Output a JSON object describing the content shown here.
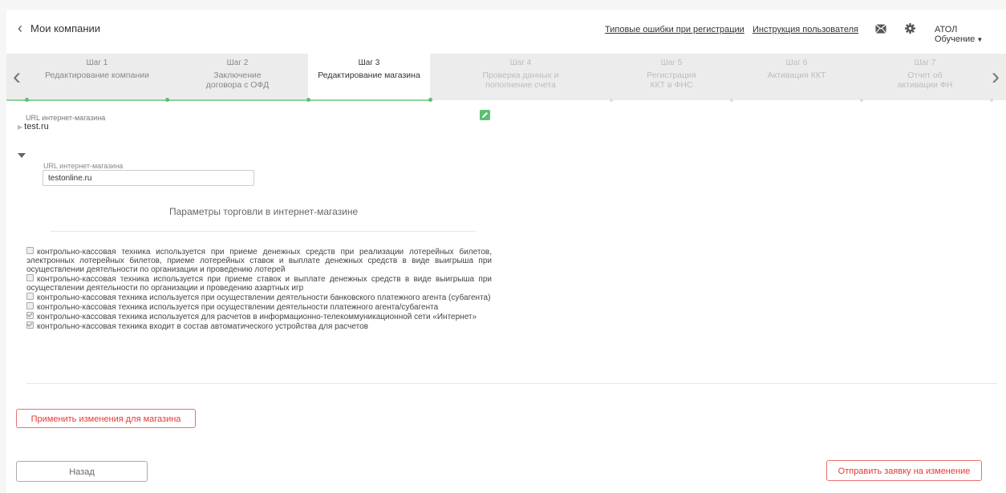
{
  "header": {
    "back_label": "Мои компании",
    "link_errors": "Типовые ошибки при регистрации",
    "link_manual": "Инструкция пользователя",
    "user_name": "АТОЛ Обучение"
  },
  "steps": [
    {
      "title": "Шаг 1",
      "desc": "Редактирование компании"
    },
    {
      "title": "Шаг 2",
      "desc": "Заключение договора с ОФД"
    },
    {
      "title": "Шаг 3",
      "desc": "Редактирование магазина"
    },
    {
      "title": "Шаг 4",
      "desc": "Проверка данных и пополнение счета"
    },
    {
      "title": "Шаг 5",
      "desc": "Регистрация ККТ в ФНС"
    },
    {
      "title": "Шаг 6",
      "desc": "Активация ККТ"
    },
    {
      "title": "Шаг 7",
      "desc": "Отчет об активации ФН"
    }
  ],
  "store": {
    "url_label": "URL интернет-магазина",
    "url_value": "test.ru"
  },
  "form": {
    "url_label": "URL интернет-магазина",
    "url_value": "testonline.ru",
    "section_title": "Параметры торговли в интернет-магазине",
    "options": [
      {
        "label": "контрольно-кассовая техника используется при приеме денежных средств при реализации лотерейных билетов, электронных лотерейных билетов, приеме лотерейных ставок и выплате денежных средств в виде выигрыша при осуществлении деятельности по организации и проведению лотерей",
        "checked": false
      },
      {
        "label": "контрольно-кассовая техника используется при приеме ставок и выплате денежных средств в виде выигрыша при осуществлении деятельности по организации и проведению азартных игр",
        "checked": false
      },
      {
        "label": "контрольно-кассовая техника используется при осуществлении деятельности банковского платежного агента (субагента)",
        "checked": false
      },
      {
        "label": "контрольно-кассовая техника используется при осуществлении деятельности платежного агента/субагента",
        "checked": false
      },
      {
        "label": "контрольно-кассовая техника используется для расчетов в информационно-телекоммуникационной сети «Интернет»",
        "checked": true
      },
      {
        "label": "контрольно-кассовая техника входит в состав автоматического устройства для расчетов",
        "checked": true
      }
    ]
  },
  "buttons": {
    "apply": "Применить изменения для магазина",
    "back": "Назад",
    "send": "Отправить заявку на изменение"
  },
  "colors": {
    "accent_red": "#e53935",
    "progress_green": "#5cbf73"
  }
}
